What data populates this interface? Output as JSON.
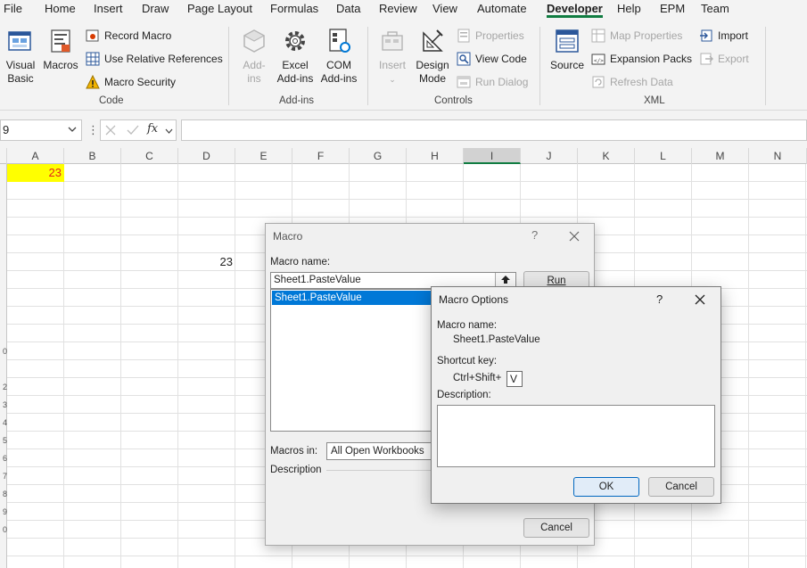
{
  "menu": {
    "tabs": [
      "File",
      "Home",
      "Insert",
      "Draw",
      "Page Layout",
      "Formulas",
      "Data",
      "Review",
      "View",
      "Automate",
      "Developer",
      "Help",
      "EPM",
      "Team"
    ],
    "active": "Developer"
  },
  "ribbon": {
    "code": {
      "visual_basic": [
        "Visual",
        "Basic"
      ],
      "macros": "Macros",
      "record_macro": "Record Macro",
      "use_relative_references": "Use Relative References",
      "macro_security": "Macro Security",
      "group_label": "Code"
    },
    "addins": {
      "addins": [
        "Add-",
        "ins"
      ],
      "excel_addins": [
        "Excel",
        "Add-ins"
      ],
      "com_addins": [
        "COM",
        "Add-ins"
      ],
      "group_label": "Add-ins"
    },
    "controls": {
      "insert": "Insert",
      "design_mode": [
        "Design",
        "Mode"
      ],
      "properties": "Properties",
      "view_code": "View Code",
      "run_dialog": "Run Dialog",
      "group_label": "Controls"
    },
    "xml": {
      "source": "Source",
      "map_properties": "Map Properties",
      "expansion_packs": "Expansion Packs",
      "refresh_data": "Refresh Data",
      "import": "Import",
      "export": "Export",
      "group_label": "XML"
    }
  },
  "formula_bar": {
    "name_box": "9",
    "formula": ""
  },
  "grid": {
    "columns": [
      "A",
      "B",
      "C",
      "D",
      "E",
      "F",
      "G",
      "H",
      "I",
      "J",
      "K",
      "L",
      "M",
      "N"
    ],
    "selected_column": "I",
    "row_labels": [
      "",
      "",
      "",
      "",
      "",
      "",
      "",
      "",
      "",
      "",
      "0",
      "",
      "2",
      "3",
      "4",
      "5",
      "6",
      "7",
      "8",
      "9",
      "0"
    ],
    "cell_a1": "23",
    "cell_d7": "23",
    "accent_colors": {
      "highlight": "#ffff00",
      "text_red": "#e3261b",
      "selection": "#107c41"
    }
  },
  "macro_dialog": {
    "title": "Macro",
    "help": "?",
    "macro_name_label": "Macro name:",
    "macro_name_value": "Sheet1.PasteValue",
    "list_items": [
      "Sheet1.PasteValue"
    ],
    "run_button": "Run",
    "macros_in_label": "Macros in:",
    "macros_in_value": "All Open Workbooks",
    "description_label": "Description",
    "cancel_button": "Cancel"
  },
  "options_dialog": {
    "title": "Macro Options",
    "help": "?",
    "macro_name_label": "Macro name:",
    "macro_name_value": "Sheet1.PasteValue",
    "shortcut_label": "Shortcut key:",
    "shortcut_prefix": "Ctrl+Shift+",
    "shortcut_value": "V",
    "description_label": "Description:",
    "description_value": "",
    "ok_button": "OK",
    "cancel_button": "Cancel"
  }
}
